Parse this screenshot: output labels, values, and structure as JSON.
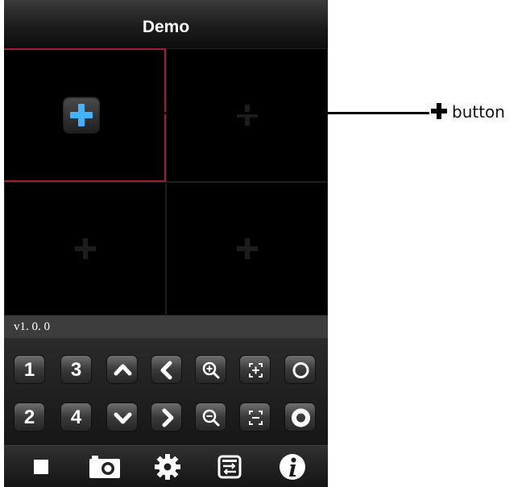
{
  "app": {
    "title": "Demo",
    "version": "v1. 0. 0"
  },
  "grid": {
    "cells": [
      {
        "id": "channel-1",
        "selected": true
      },
      {
        "id": "channel-2",
        "selected": false
      },
      {
        "id": "channel-3",
        "selected": false
      },
      {
        "id": "channel-4",
        "selected": false
      }
    ]
  },
  "controls": {
    "channel_keys": [
      "1",
      "3",
      "2",
      "4"
    ],
    "icons": [
      "arrow-up",
      "arrow-left",
      "zoom-in",
      "focus-in",
      "iris-open",
      "arrow-down",
      "arrow-right",
      "zoom-out",
      "focus-out",
      "iris-close"
    ]
  },
  "tabbar": {
    "icons": [
      "stop-icon",
      "snapshot-camera-icon",
      "settings-gear-icon",
      "playback-icon",
      "info-icon"
    ]
  },
  "annotation": {
    "label": "button"
  },
  "colors": {
    "accent_plus": "#43b2ff",
    "selection_border": "#a21e2c"
  }
}
